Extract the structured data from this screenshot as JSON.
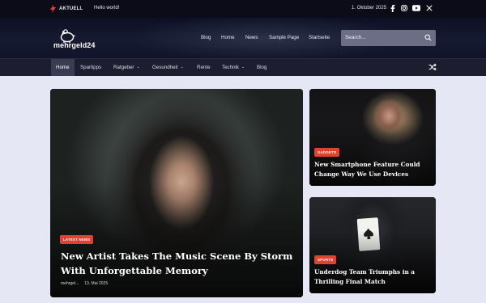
{
  "topbar": {
    "breaking_label": "AKTUELL",
    "breaking_text": "Hello world!",
    "date": "1. Oktober 2025",
    "social_icons": [
      "facebook-icon",
      "instagram-icon",
      "youtube-icon",
      "x-icon"
    ]
  },
  "header": {
    "logo_text": "mehrgeld24",
    "nav": [
      "Blog",
      "Home",
      "News",
      "Sample Page",
      "Startseite"
    ],
    "search_placeholder": "Search..."
  },
  "navbar": {
    "items": [
      {
        "label": "Home",
        "active": true,
        "dropdown": false
      },
      {
        "label": "Spartipps",
        "active": false,
        "dropdown": false
      },
      {
        "label": "Ratgeber",
        "active": false,
        "dropdown": true
      },
      {
        "label": "Gesundheit",
        "active": false,
        "dropdown": true
      },
      {
        "label": "Rente",
        "active": false,
        "dropdown": false
      },
      {
        "label": "Technik",
        "active": false,
        "dropdown": true
      },
      {
        "label": "Blog",
        "active": false,
        "dropdown": false
      }
    ],
    "shuffle_icon": "shuffle-icon"
  },
  "featured": {
    "category": "LATEST NEWS",
    "title": "New Artist Takes The Music Scene By Storm With Unforgettable Memory",
    "author": "mehrgel...",
    "date": "13. Mai 2025"
  },
  "side_posts": [
    {
      "category": "GADGETS",
      "title": "New Smartphone Feature Could Change Way We Use Devices"
    },
    {
      "category": "SPORTS",
      "title": "Underdog Team Triumphs in a Thrilling Final Match"
    }
  ],
  "colors": {
    "accent": "#e2412f",
    "topbar_bg": "#0b0c17",
    "navbar_bg": "#1c1e2f",
    "page_bg": "#e6e7f5"
  }
}
